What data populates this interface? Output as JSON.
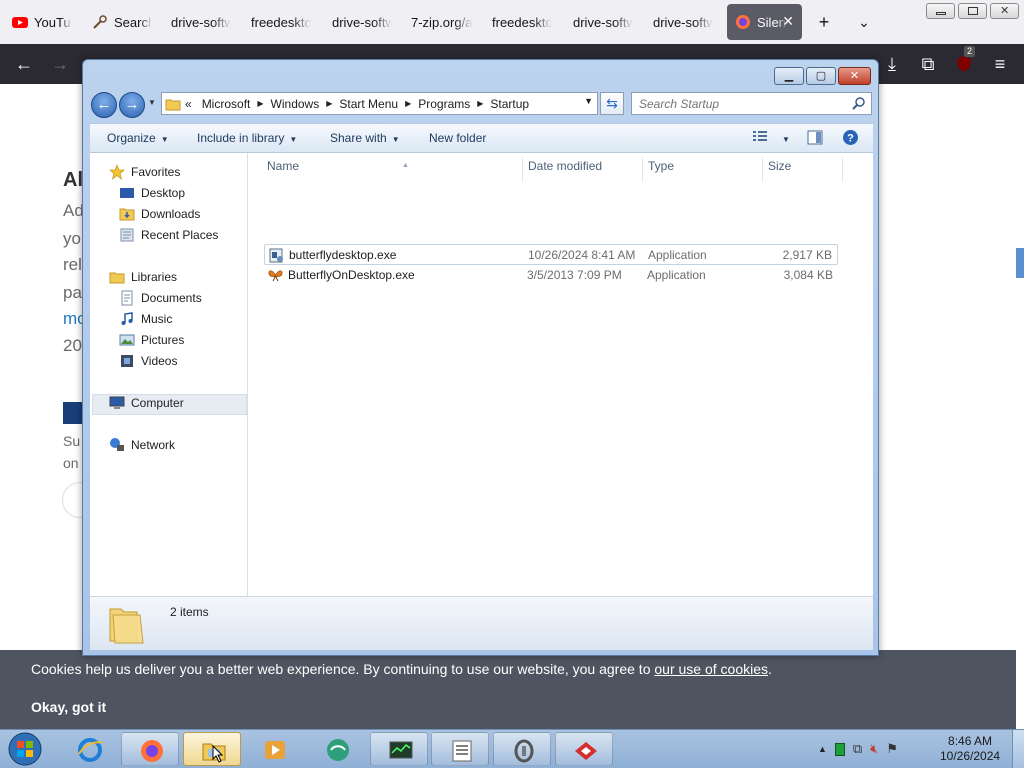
{
  "browser": {
    "tabs": [
      {
        "label": "YouTube",
        "icon": "youtube-icon"
      },
      {
        "label": "Search",
        "icon": "search-tool-icon"
      },
      {
        "label": "drive-software",
        "icon": "none"
      },
      {
        "label": "freedesktop",
        "icon": "none"
      },
      {
        "label": "drive-software",
        "icon": "none"
      },
      {
        "label": "7-zip.org/a",
        "icon": "none"
      },
      {
        "label": "freedesktop",
        "icon": "none"
      },
      {
        "label": "drive-software",
        "icon": "none"
      },
      {
        "label": "drive-software",
        "icon": "none"
      },
      {
        "label": "Silent",
        "icon": "firefox-icon"
      }
    ],
    "extension_badge": "2"
  },
  "background_page": {
    "heading": "Al",
    "lines": [
      "Ad",
      "yo",
      "rel",
      "pa",
      "mo",
      "20"
    ],
    "link_line_index": 4,
    "lines_lower": [
      "Su",
      "on"
    ],
    "cookie_text": "Cookies help us deliver you a better web experience. By continuing to use our website, you agree to",
    "cookie_link": "our use of cookies",
    "cookie_period": ".",
    "cookie_button": "Okay, got it"
  },
  "explorer": {
    "address": {
      "prefix": "«",
      "crumbs": [
        "Microsoft",
        "Windows",
        "Start Menu",
        "Programs",
        "Startup"
      ]
    },
    "search_placeholder": "Search Startup",
    "commands": {
      "organize": "Organize",
      "include": "Include in library",
      "share": "Share with",
      "new_folder": "New folder"
    },
    "nav": {
      "favorites": "Favorites",
      "desktop": "Desktop",
      "downloads": "Downloads",
      "recent": "Recent Places",
      "libraries": "Libraries",
      "documents": "Documents",
      "music": "Music",
      "pictures": "Pictures",
      "videos": "Videos",
      "computer": "Computer",
      "network": "Network"
    },
    "columns": {
      "name": "Name",
      "date": "Date modified",
      "type": "Type",
      "size": "Size"
    },
    "files": [
      {
        "name": "butterflydesktop.exe",
        "date": "10/26/2024 8:41 AM",
        "type": "Application",
        "size": "2,917 KB",
        "icon": "exe-setup-icon"
      },
      {
        "name": "ButterflyOnDesktop.exe",
        "date": "3/5/2013 7:09 PM",
        "type": "Application",
        "size": "3,084 KB",
        "icon": "butterfly-icon"
      }
    ],
    "status": "2 items"
  },
  "taskbar": {
    "clock_time": "8:46 AM",
    "clock_date": "10/26/2024"
  },
  "colors": {
    "browser_toolbar": "#2b2a33",
    "cookie_bar": "#4e5560",
    "close_red": "#c0402a"
  }
}
